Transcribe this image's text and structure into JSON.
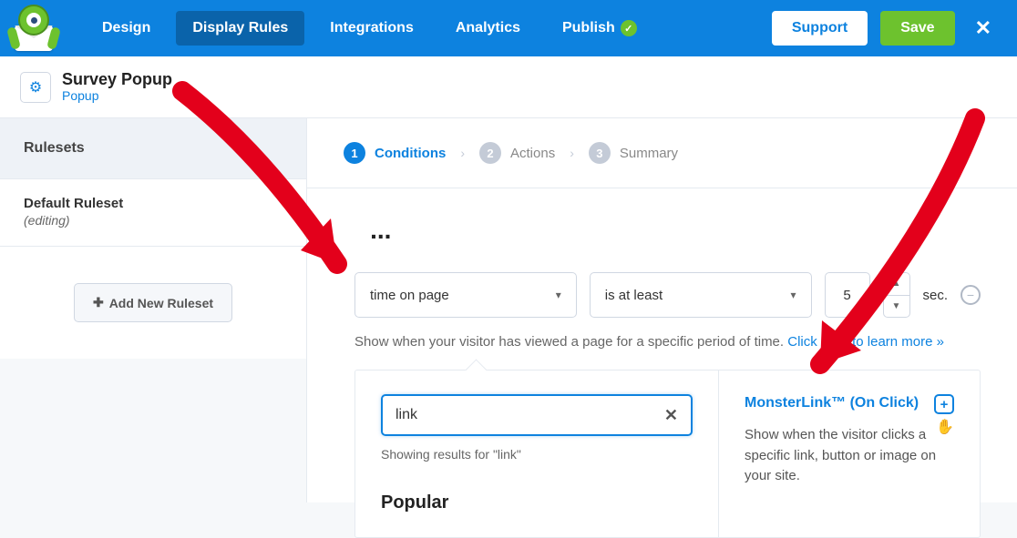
{
  "nav": {
    "design": "Design",
    "display_rules": "Display Rules",
    "integrations": "Integrations",
    "analytics": "Analytics",
    "publish": "Publish",
    "support": "Support",
    "save": "Save"
  },
  "subheader": {
    "title": "Survey Popup",
    "type": "Popup"
  },
  "sidebar": {
    "heading": "Rulesets",
    "default_title": "Default Ruleset",
    "editing": "(editing)",
    "add_button": "Add New Ruleset"
  },
  "steps": {
    "s1": "Conditions",
    "s2": "Actions",
    "s3": "Summary"
  },
  "content": {
    "heading_tail": "...",
    "select1": "time on page",
    "select2": "is at least",
    "number_value": "5",
    "sec": "sec.",
    "hint_prefix": "Show when your visitor has viewed a page for a specific period of time. ",
    "hint_link": "Click here to learn more »"
  },
  "dropdown": {
    "search_value": "link",
    "results_for": "Showing results for \"link\"",
    "popular": "Popular",
    "ml_title": "MonsterLink™ (On Click)",
    "ml_desc": "Show when the visitor clicks a specific link, button or image on your site."
  }
}
